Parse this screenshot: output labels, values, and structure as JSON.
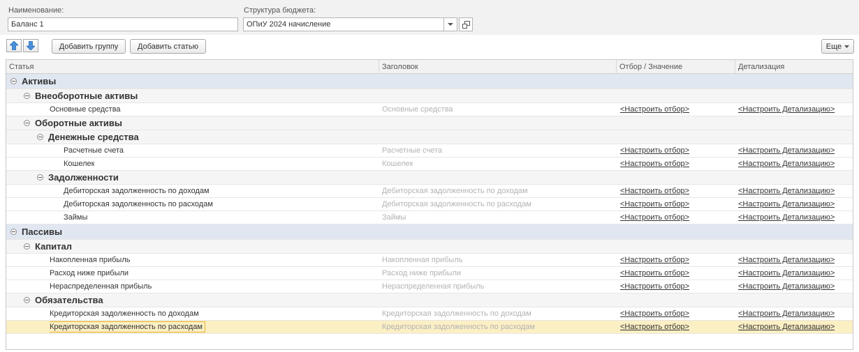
{
  "form": {
    "name_label": "Наименование:",
    "name_value": "Баланс 1",
    "structure_label": "Структура бюджета:",
    "structure_value": "ОПиУ 2024 начисление"
  },
  "toolbar": {
    "add_group_label": "Добавить группу",
    "add_item_label": "Добавить статью",
    "more_label": "Еще"
  },
  "table": {
    "columns": [
      "Статья",
      "Заголовок",
      "Отбор / Значение",
      "Детализация"
    ],
    "rows": [
      {
        "type": "group",
        "level": 0,
        "label": "Активы"
      },
      {
        "type": "group",
        "level": 1,
        "label": "Внеоборотные активы"
      },
      {
        "type": "item",
        "level": 2,
        "label": "Основные средства",
        "heading": "Основные средства",
        "filter": "<Настроить отбор>",
        "detail": "<Настроить Детализацию>"
      },
      {
        "type": "group",
        "level": 1,
        "label": "Оборотные активы"
      },
      {
        "type": "group",
        "level": 2,
        "label": "Денежные средства"
      },
      {
        "type": "item",
        "level": 3,
        "label": "Расчетные счета",
        "heading": "Расчетные счета",
        "filter": "<Настроить отбор>",
        "detail": "<Настроить Детализацию>"
      },
      {
        "type": "item",
        "level": 3,
        "label": "Кошелек",
        "heading": "Кошелек",
        "filter": "<Настроить отбор>",
        "detail": "<Настроить Детализацию>"
      },
      {
        "type": "group",
        "level": 2,
        "label": "Задолженности"
      },
      {
        "type": "item",
        "level": 3,
        "label": "Дебиторская задолженность по доходам",
        "heading": "Дебиторская задолженность по доходам",
        "filter": "<Настроить отбор>",
        "detail": "<Настроить Детализацию>"
      },
      {
        "type": "item",
        "level": 3,
        "label": "Дебиторская задолженность по расходам",
        "heading": "Дебиторская задолженность по расходам",
        "filter": "<Настроить отбор>",
        "detail": "<Настроить Детализацию>"
      },
      {
        "type": "item",
        "level": 3,
        "label": "Займы",
        "heading": "Займы",
        "filter": "<Настроить отбор>",
        "detail": "<Настроить Детализацию>"
      },
      {
        "type": "group",
        "level": 0,
        "label": "Пассивы"
      },
      {
        "type": "group",
        "level": 1,
        "label": "Капитал"
      },
      {
        "type": "item",
        "level": 2,
        "label": "Накопленная прибыль",
        "heading": "Накопленная прибыль",
        "filter": "<Настроить отбор>",
        "detail": "<Настроить Детализацию>"
      },
      {
        "type": "item",
        "level": 2,
        "label": "Расход ниже прибыли",
        "heading": "Расход ниже прибыли",
        "filter": "<Настроить отбор>",
        "detail": "<Настроить Детализацию>"
      },
      {
        "type": "item",
        "level": 2,
        "label": "Нераспределенная прибыль",
        "heading": "Нераспределенная прибыль",
        "filter": "<Настроить отбор>",
        "detail": "<Настроить Детализацию>"
      },
      {
        "type": "group",
        "level": 1,
        "label": "Обязательства"
      },
      {
        "type": "item",
        "level": 2,
        "label": "Кредиторская задолженность по доходам",
        "heading": "Кредиторская задолженность по доходам",
        "filter": "<Настроить отбор>",
        "detail": "<Настроить Детализацию>"
      },
      {
        "type": "item",
        "level": 2,
        "label": "Кредиторская задолженность по расходам",
        "heading": "Кредиторская задолженность по расходам",
        "filter": "<Настроить отбор>",
        "detail": "<Настроить Детализацию>",
        "selected": true
      }
    ]
  },
  "icons": {
    "move_up": "arrow-up-icon",
    "move_down": "arrow-down-icon",
    "dropdown": "chevron-down-icon",
    "open": "open-window-icon",
    "collapse": "collapse-icon"
  },
  "colors": {
    "accent_arrow": "#4a90d9",
    "group_level0_bg": "#e0e7f1",
    "selected_row_bg": "#fbefc4",
    "selected_border": "#e8b22c"
  }
}
